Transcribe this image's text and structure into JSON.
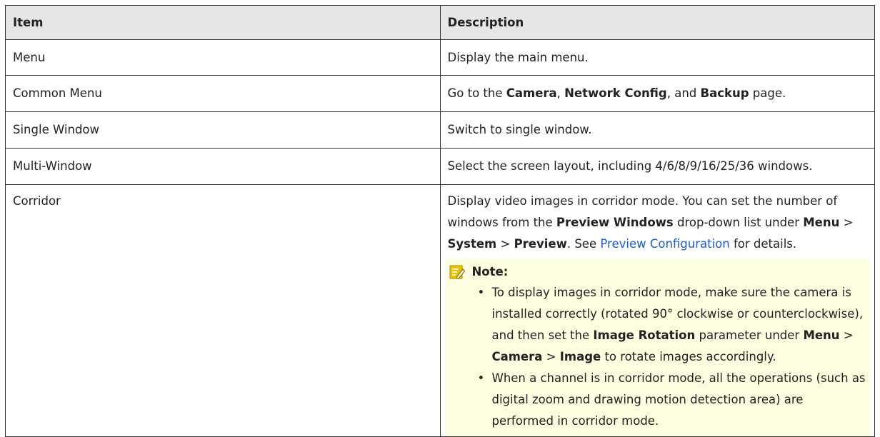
{
  "table": {
    "headers": {
      "item": "Item",
      "description": "Description"
    },
    "rows": [
      {
        "item": "Menu",
        "description": "Display the main menu."
      },
      {
        "item": "Common Menu",
        "desc_parts": [
          "Go to the ",
          "Camera",
          ", ",
          "Network Config",
          ", and ",
          "Backup",
          " page."
        ]
      },
      {
        "item": "Single Window",
        "description": "Switch to single window."
      },
      {
        "item": "Multi-Window",
        "description": "Select the screen layout, including 4/6/8/9/16/25/36 windows."
      },
      {
        "item": "Corridor",
        "desc_parts": [
          "Display video images in corridor mode. You can set the number of windows from the ",
          "Preview Windows",
          " drop-down list under ",
          "Menu",
          " > ",
          "System",
          " > ",
          "Preview",
          ". See ",
          "Preview Configuration",
          " for details."
        ],
        "note": {
          "title": "Note:",
          "bullet1_parts": [
            "To display images in corridor mode, make sure the camera is installed correctly (rotated 90° clockwise or counterclockwise), and then set the ",
            "Image Rotation",
            " parameter under ",
            "Menu",
            " > ",
            "Camera",
            " > ",
            "Image",
            " to rotate images accordingly."
          ],
          "bullet2": "When a channel is in corridor mode, all the operations (such as digital zoom and drawing motion detection area) are performed in corridor mode."
        }
      }
    ]
  },
  "colors": {
    "header_bg": "#e6e6e6",
    "note_bg": "#fdfde0",
    "link": "#1a5bd6",
    "note_icon": "#e8c400"
  },
  "icons": {
    "note": "note-pencil-icon"
  }
}
